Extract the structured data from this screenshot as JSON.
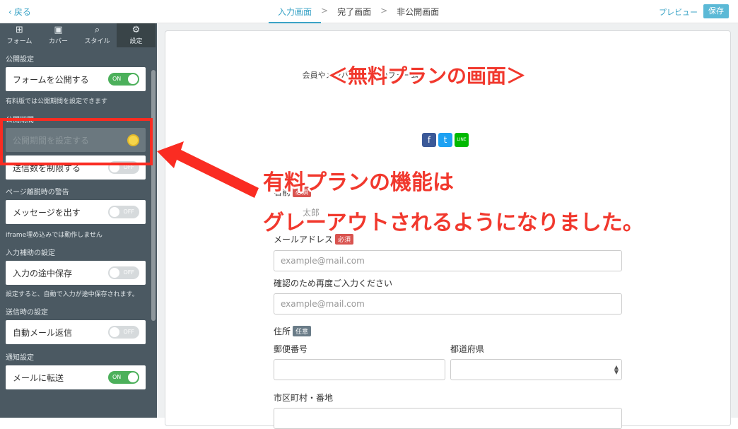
{
  "topbar": {
    "back_label": "戻る",
    "steps": [
      "入力画面",
      "完了画面",
      "非公開画面"
    ],
    "step_separator": ">",
    "preview_label": "プレビュー",
    "save_label": "保存"
  },
  "sidebar": {
    "tabs": [
      {
        "label": "フォーム",
        "icon": "plus-square-icon"
      },
      {
        "label": "カバー",
        "icon": "image-icon"
      },
      {
        "label": "スタイル",
        "icon": "brush-icon"
      },
      {
        "label": "設定",
        "icon": "gear-icon",
        "active": true
      }
    ],
    "publish_heading": "公開設定",
    "publish_form_label": "フォームを公開する",
    "publish_form_toggle": "ON",
    "paid_note": "有料版では公開期間を設定できます",
    "period_heading": "公開期間",
    "period_label": "公開期間を設定する",
    "limit_label": "送信数を制限する",
    "limit_toggle": "OFF",
    "leave_heading": "ページ離脱時の警告",
    "leave_label": "メッセージを出す",
    "leave_toggle": "OFF",
    "iframe_note": "iframe埋め込みでは動作しません",
    "assist_heading": "入力補助の設定",
    "assist_label": "入力の途中保存",
    "assist_toggle": "OFF",
    "assist_note": "設定すると、自動で入力が途中保存されます。",
    "send_heading": "送信時の設定",
    "send_label": "自動メール返信",
    "send_toggle": "OFF",
    "notify_heading": "通知設定",
    "notify_label": "メールに転送",
    "notify_toggle": "ON"
  },
  "form": {
    "description": "会員やメンバー登録用のフォーム",
    "share_icons": [
      "facebook-icon",
      "twitter-icon",
      "line-icon"
    ],
    "share_text": {
      "facebook": "f",
      "twitter": "t",
      "line": "LINE"
    },
    "name_label": "名前",
    "required_badge": "必須",
    "optional_badge": "任意",
    "name_placeholder": "太郎",
    "email_label": "メールアドレス",
    "email_placeholder": "example@mail.com",
    "email_confirm_label": "確認のため再度ご入力ください",
    "email_confirm_placeholder": "example@mail.com",
    "address_label": "住所",
    "zip_label": "郵便番号",
    "pref_label": "都道府県",
    "city_label": "市区町村・番地"
  },
  "annotations": {
    "title": "＜無料プランの画面＞",
    "line1": "有料プランの機能は",
    "line2": "グレーアウトされるようになりました。"
  },
  "colors": {
    "accent": "#3aa3c6",
    "sidebar_bg": "#4b5962",
    "toggle_on": "#4cb05b",
    "annotation_red": "#f1382d"
  }
}
